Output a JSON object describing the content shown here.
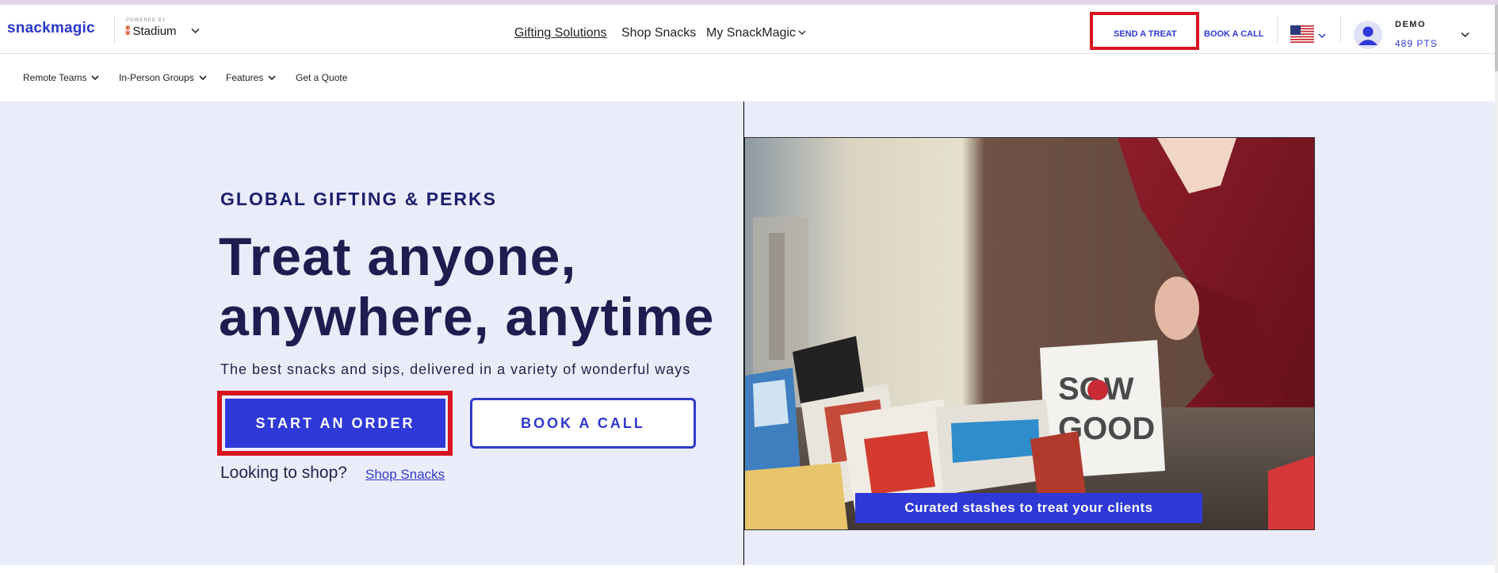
{
  "header": {
    "logo": "snackmagic",
    "powered_by": "POWERED BY",
    "partner": "Stadium",
    "nav": {
      "gifting": "Gifting Solutions",
      "shop": "Shop Snacks",
      "my": "My SnackMagic"
    },
    "send_treat": "SEND A TREAT",
    "book_call": "BOOK A CALL",
    "country_flag": "us-flag-icon",
    "user": {
      "name": "DEMO",
      "points": "489 PTS"
    }
  },
  "subnav": {
    "items": [
      "Remote Teams",
      "In-Person Groups",
      "Features",
      "Get a Quote"
    ]
  },
  "hero": {
    "eyebrow": "GLOBAL GIFTING & PERKS",
    "headline_line1": "Treat anyone,",
    "headline_line2": "anywhere, anytime",
    "subtext": "The best snacks and sips, delivered in a variety of wonderful ways",
    "primary_cta": "START AN ORDER",
    "secondary_cta": "BOOK A CALL",
    "looking": "Looking to shop?",
    "shop_link": "Shop Snacks",
    "image_caption": "Curated stashes to treat your clients",
    "image_bag_text": "SOW GOOD"
  },
  "colors": {
    "brand_blue": "#2e39d8",
    "highlight_red": "#d7141f",
    "hero_bg": "#ebecfa",
    "headline": "#1d1d4f"
  }
}
